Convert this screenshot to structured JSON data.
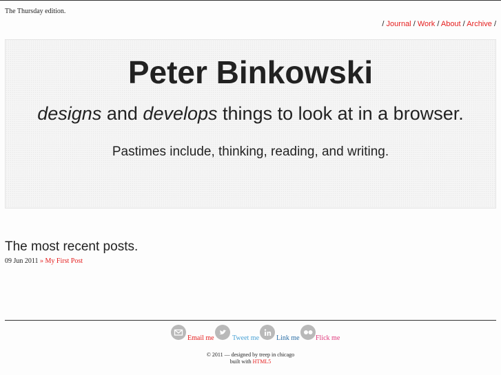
{
  "header": {
    "edition": "The Thursday edition.",
    "nav": [
      {
        "label": "Journal"
      },
      {
        "label": "Work"
      },
      {
        "label": "About"
      },
      {
        "label": "Archive"
      }
    ],
    "separator": "/"
  },
  "hero": {
    "name": "Peter Binkowski",
    "tagline_em1": "designs",
    "tagline_and": "and",
    "tagline_em2": "develops",
    "tagline_rest": "things to look at in a browser.",
    "pastimes": "Pastimes include, thinking, reading, and writing."
  },
  "recent": {
    "title": "The most recent posts.",
    "posts": [
      {
        "date": "09 Jun 2011",
        "sep": "»",
        "title": "My First Post"
      }
    ]
  },
  "social": {
    "email": {
      "label": "Email me",
      "icon": "mail-icon"
    },
    "tweet": {
      "label": "Tweet me",
      "icon": "twitter-bird-icon"
    },
    "link": {
      "label": "Link me",
      "icon": "linkedin-icon"
    },
    "flick": {
      "label": "Flick me",
      "icon": "flickr-icon"
    }
  },
  "footer": {
    "credit": "© 2011 — designed by treep in chicago",
    "built_prefix": "built with",
    "built_link": "HTML5"
  },
  "colors": {
    "accent": "#e51d1d",
    "twitter": "#4aa3d6",
    "linkedin": "#2a6ea6",
    "flickr": "#e0367a"
  }
}
